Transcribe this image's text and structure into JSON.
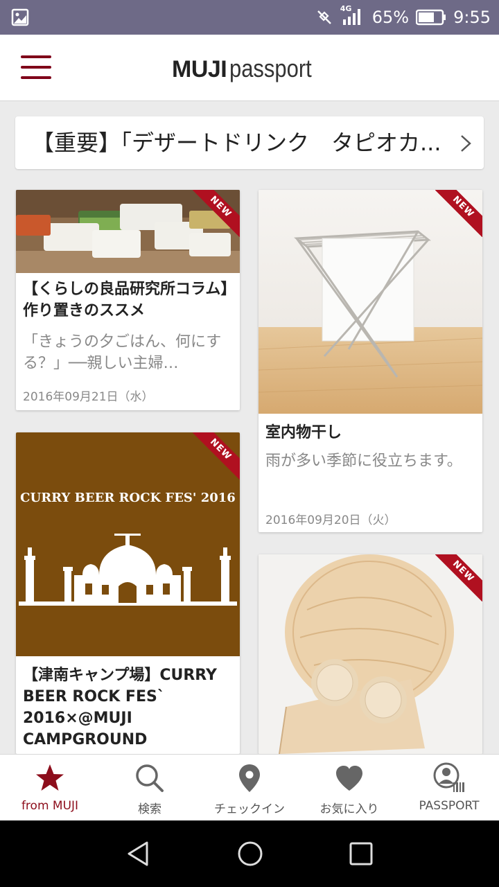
{
  "status_bar": {
    "network": "4G",
    "battery": "65%",
    "time": "9:55"
  },
  "app_bar": {
    "brand_bold": "MUJI",
    "brand_light": "passport"
  },
  "notice": {
    "text": "【重要】「デザートドリンク　タピオカ..."
  },
  "cards": [
    {
      "badge": "NEW",
      "title": "【くらしの良品研究所コラム】作り置きのススメ",
      "description": "「きょうの夕ごはん、何にする？」──親しい主婦…",
      "date": "2016年09月21日（水）"
    },
    {
      "badge": "NEW",
      "title": "室内物干し",
      "description": "雨が多い季節に役立ちます。",
      "date": "2016年09月20日（火）"
    },
    {
      "badge": "NEW",
      "image_text": "CURRY BEER ROCK FES' 2016",
      "title": "【津南キャンプ場】CURRY BEER ROCK FES` 2016×@MUJI CAMPGROUND"
    },
    {
      "badge": "NEW"
    }
  ],
  "bottom_nav": [
    {
      "label": "from MUJI",
      "icon": "star-icon"
    },
    {
      "label": "検索",
      "icon": "search-icon"
    },
    {
      "label": "チェックイン",
      "icon": "location-pin-icon"
    },
    {
      "label": "お気に入り",
      "icon": "heart-icon"
    },
    {
      "label": "PASSPORT",
      "icon": "passport-user-icon"
    }
  ],
  "colors": {
    "accent": "#8d0e1c",
    "status_bar": "#6e6a87",
    "ribbon": "#b01020",
    "poster_bg": "#7b4c0d"
  }
}
